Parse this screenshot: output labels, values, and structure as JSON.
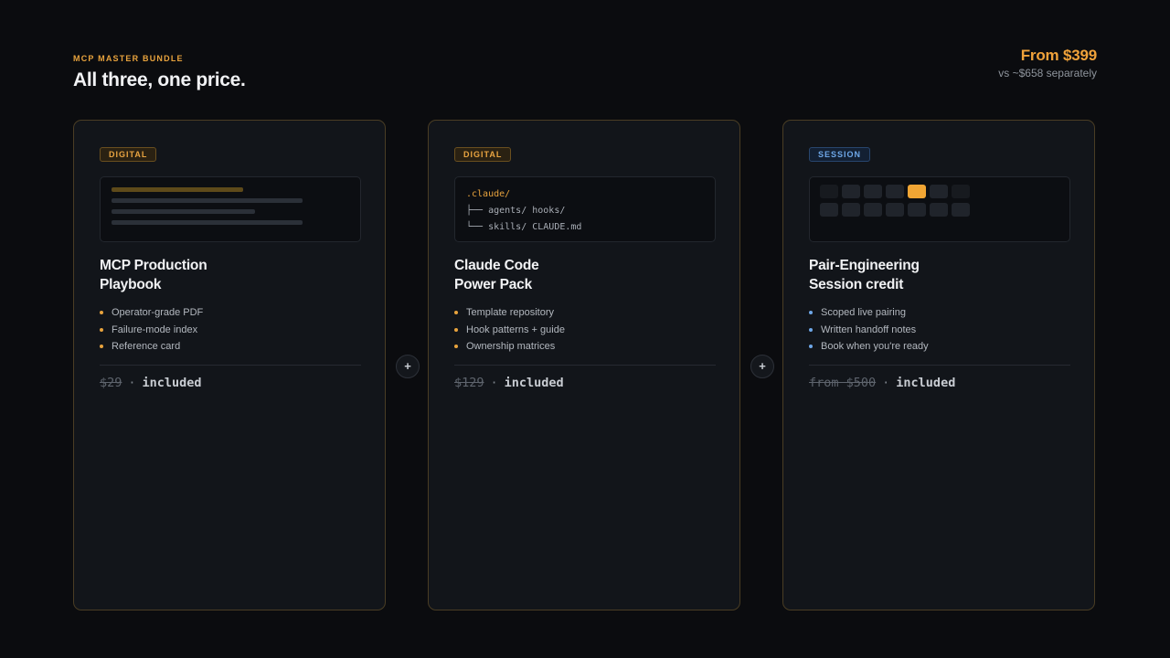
{
  "header": {
    "eyebrow": "MCP MASTER BUNDLE",
    "headline": "All three, one price.",
    "price": "From $399",
    "compare": "vs ~$658 separately"
  },
  "colors": {
    "accent": "#f0a23a",
    "session_accent": "#6ea7e8",
    "background": "#0b0c0f",
    "card": "#12151a"
  },
  "plus_symbol": "+",
  "cards": [
    {
      "badge": "DIGITAL",
      "title_line1": "MCP Production",
      "title_line2": "Playbook",
      "features": [
        "Operator-grade PDF",
        "Failure-mode index",
        "Reference card"
      ],
      "price_original": "$29",
      "price_sep": "·",
      "price_status": "included"
    },
    {
      "badge": "DIGITAL",
      "code": {
        "root": ".claude/",
        "line2": "├── agents/ hooks/",
        "line3": "└── skills/ CLAUDE.md"
      },
      "title_line1": "Claude Code",
      "title_line2": "Power Pack",
      "features": [
        "Template repository",
        "Hook patterns + guide",
        "Ownership matrices"
      ],
      "price_original": "$129",
      "price_sep": "·",
      "price_status": "included"
    },
    {
      "badge": "SESSION",
      "title_line1": "Pair-Engineering",
      "title_line2": "Session credit",
      "features": [
        "Scoped live pairing",
        "Written handoff notes",
        "Book when you're ready"
      ],
      "price_original": "from $500",
      "price_sep": "·",
      "price_status": "included"
    }
  ]
}
